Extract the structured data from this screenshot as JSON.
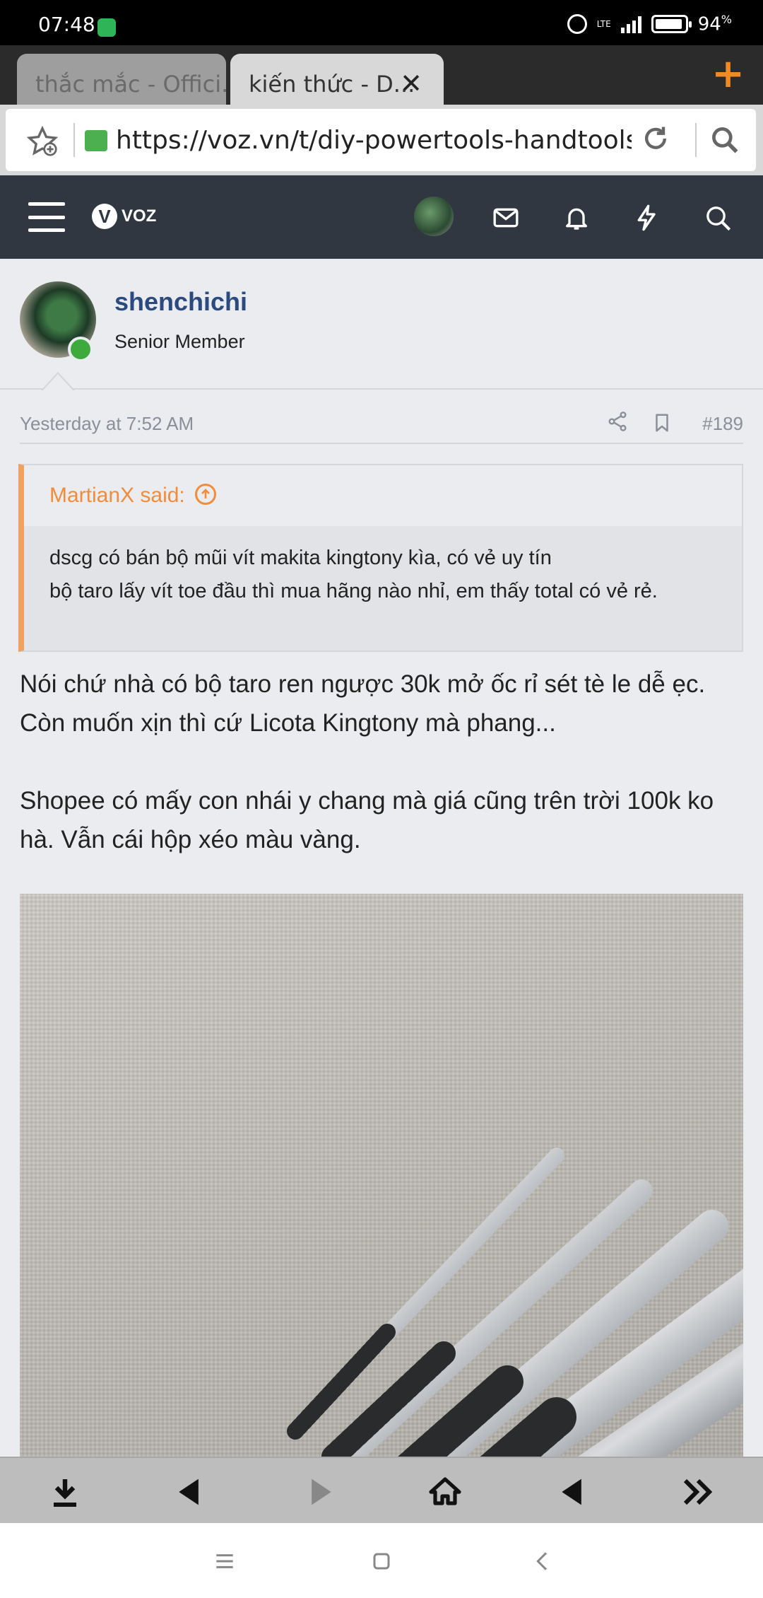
{
  "status_bar": {
    "time": "07:48",
    "network": "LTE",
    "battery": "94",
    "battery_unit": "%",
    "battery_level": 0.94
  },
  "tabs": [
    {
      "label": "thắc mắc - Offici..."
    },
    {
      "label": "kiến thức - D...",
      "close": "✕"
    }
  ],
  "new_tab": "+",
  "address_bar": {
    "url": "https://voz.vn/t/diy-powertools-handtools-c"
  },
  "site": {
    "logo_text": "VOZ"
  },
  "post": {
    "username": "shenchichi",
    "user_title": "Senior Member",
    "date": "Yesterday at 7:52 AM",
    "number": "#189",
    "quote": {
      "author": "MartianX said:",
      "lines": [
        "dscg có bán bộ mũi vít makita kingtony kìa, có vẻ uy tín",
        "bộ taro lấy vít toe đầu thì mua hãng nào nhỉ, em thấy total có vẻ rẻ."
      ]
    },
    "paragraphs": [
      "Nói chứ nhà có bộ taro ren ngược 30k mở ốc rỉ sét tè le dễ ẹc. Còn muốn xịn thì cứ Licota Kingtony mà phang...",
      "Shopee có mấy con nhái y chang mà giá cũng trên trời 100k ko hà. Vẫn cái hộp xéo màu vàng."
    ]
  },
  "colors": {
    "header": "#303740",
    "accent_orange": "#f28c3a",
    "username": "#2b4a80",
    "online": "#3daa3d"
  }
}
